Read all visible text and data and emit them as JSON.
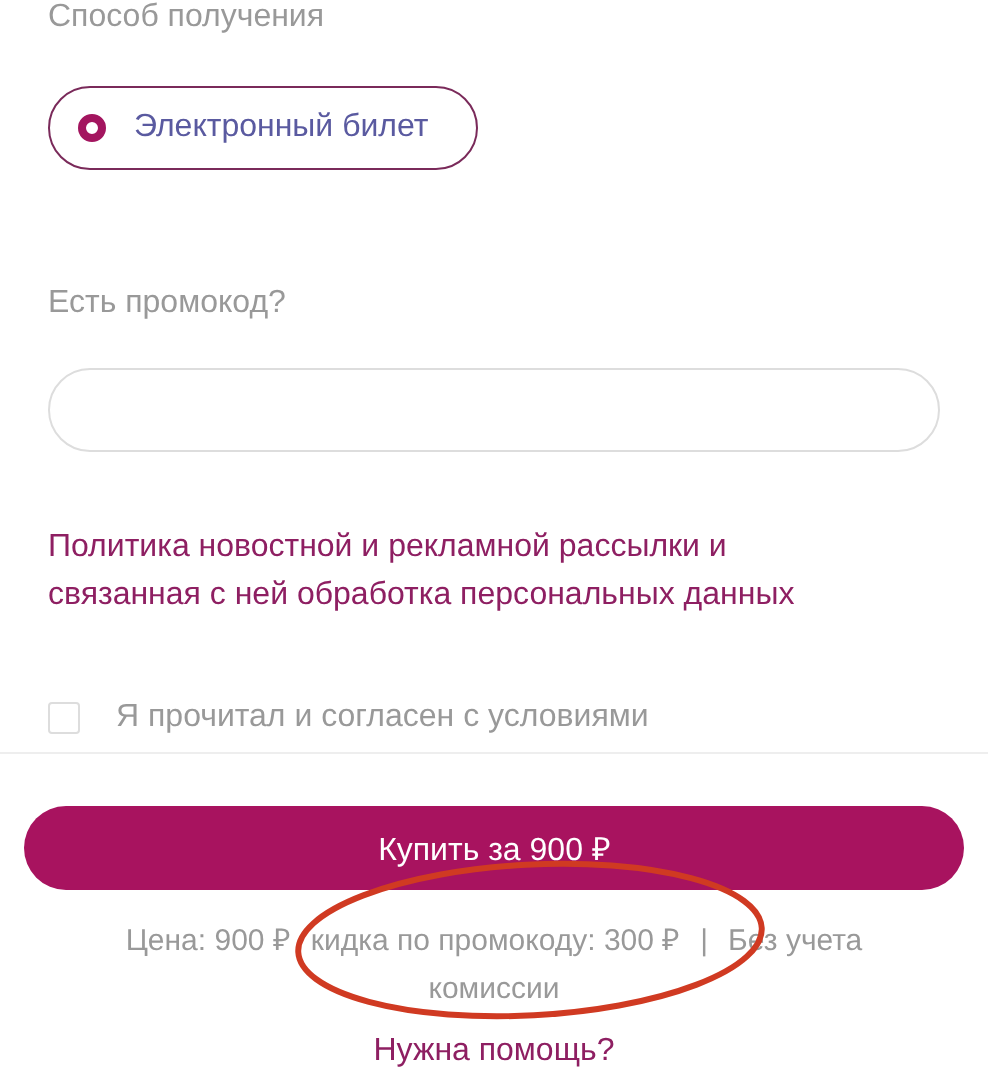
{
  "delivery": {
    "label": "Способ получения",
    "options": [
      {
        "label": "Электронный билет",
        "selected": true
      }
    ]
  },
  "promo": {
    "label": "Есть промокод?"
  },
  "policy_link": "Политика новостной и рекламной рассылки и связанная с ней обработка персональных данных",
  "agreement": {
    "label": "Я прочитал и согласен с условиями",
    "checked": false
  },
  "buy_button": "Купить за 900 ₽",
  "price_note": {
    "price": "Цена: 900 ₽",
    "discount": "кидка по промокоду: 300 ₽",
    "separator": "|",
    "tax_note": "Без учета",
    "tax_note_end": "комиссии"
  },
  "annotation": {
    "kind": "ellipse"
  },
  "help_link": "Нужна помощь?"
}
